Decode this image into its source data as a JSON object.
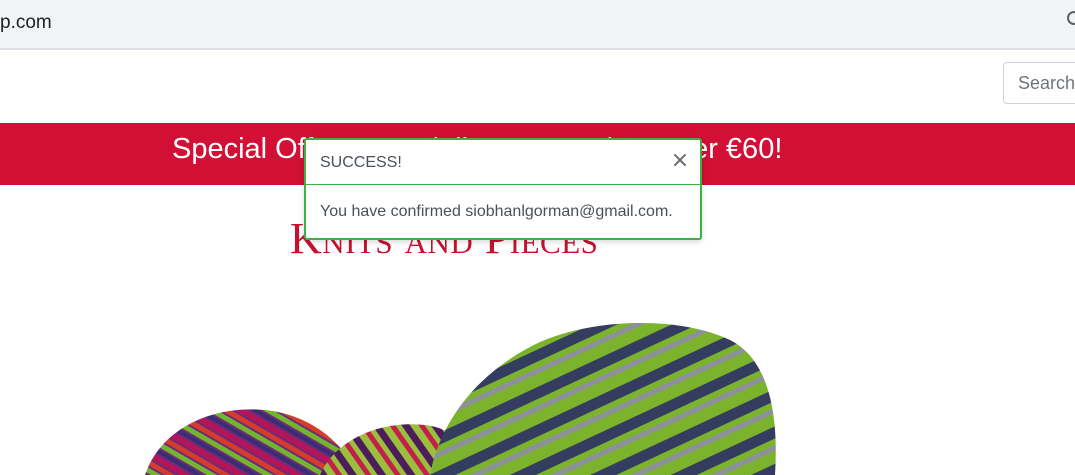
{
  "browser": {
    "address_text": "p.com"
  },
  "search": {
    "placeholder": "Search"
  },
  "banner": {
    "text": "Special Offer: Free delivery on orders over €60!"
  },
  "brand": {
    "title": "Knits and Pieces"
  },
  "toast": {
    "title": "SUCCESS!",
    "close_icon": "close-icon",
    "message": "You have confirmed siobhanlgorman@gmail.com."
  },
  "colors": {
    "banner": "#d20f35",
    "brand": "#c8102e",
    "toast_border": "#3cb043"
  }
}
